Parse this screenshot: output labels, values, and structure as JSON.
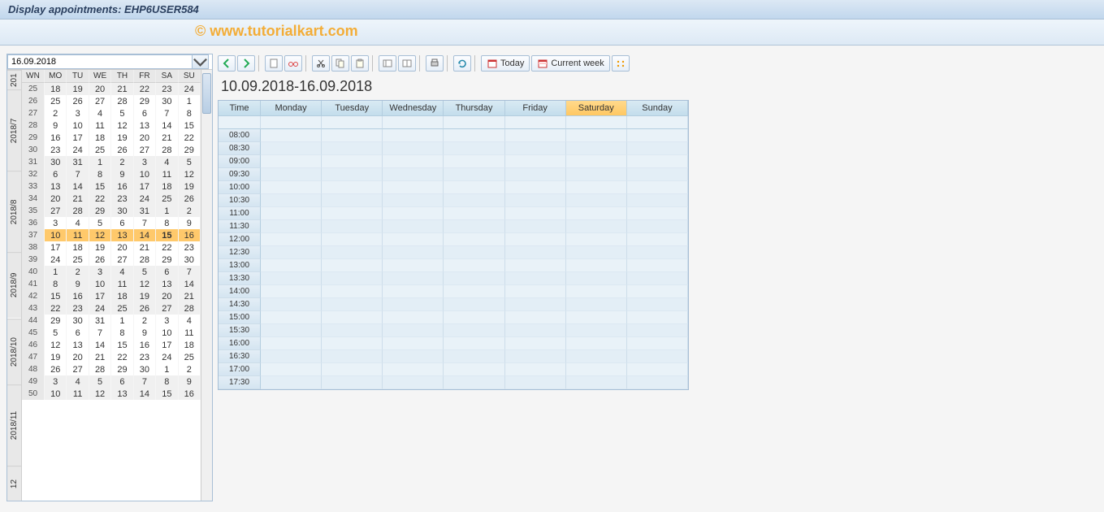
{
  "title": "Display appointments: EHP6USER584",
  "watermark": "© www.tutorialkart.com",
  "date_input": {
    "value": "16.09.2018"
  },
  "mini_cal": {
    "headers": [
      "WN",
      "MO",
      "TU",
      "WE",
      "TH",
      "FR",
      "SA",
      "SU"
    ],
    "months": [
      {
        "label": "201",
        "rows": [
          [
            25,
            18,
            19,
            20,
            21,
            22,
            23,
            24
          ]
        ],
        "class": "alt-month"
      },
      {
        "label": "2018/7",
        "rows": [
          [
            26,
            25,
            26,
            27,
            28,
            29,
            30,
            1
          ],
          [
            27,
            2,
            3,
            4,
            5,
            6,
            7,
            8
          ],
          [
            28,
            9,
            10,
            11,
            12,
            13,
            14,
            15
          ],
          [
            29,
            16,
            17,
            18,
            19,
            20,
            21,
            22
          ],
          [
            30,
            23,
            24,
            25,
            26,
            27,
            28,
            29
          ]
        ],
        "class": "cur-month"
      },
      {
        "label": "2018/8",
        "rows": [
          [
            31,
            30,
            31,
            1,
            2,
            3,
            4,
            5
          ],
          [
            32,
            6,
            7,
            8,
            9,
            10,
            11,
            12
          ],
          [
            33,
            13,
            14,
            15,
            16,
            17,
            18,
            19
          ],
          [
            34,
            20,
            21,
            22,
            23,
            24,
            25,
            26
          ],
          [
            35,
            27,
            28,
            29,
            30,
            31,
            1,
            2
          ]
        ],
        "class": "alt-month"
      },
      {
        "label": "2018/9",
        "rows": [
          [
            36,
            3,
            4,
            5,
            6,
            7,
            8,
            9
          ],
          [
            37,
            10,
            11,
            12,
            13,
            14,
            15,
            16
          ],
          [
            38,
            17,
            18,
            19,
            20,
            21,
            22,
            23
          ],
          [
            39,
            24,
            25,
            26,
            27,
            28,
            29,
            30
          ]
        ],
        "class": "cur-month",
        "highlight_wn": 37,
        "today": 15
      },
      {
        "label": "2018/10",
        "rows": [
          [
            40,
            1,
            2,
            3,
            4,
            5,
            6,
            7
          ],
          [
            41,
            8,
            9,
            10,
            11,
            12,
            13,
            14
          ],
          [
            42,
            15,
            16,
            17,
            18,
            19,
            20,
            21
          ],
          [
            43,
            22,
            23,
            24,
            25,
            26,
            27,
            28
          ]
        ],
        "class": "alt-month"
      },
      {
        "label": "2018/11",
        "rows": [
          [
            44,
            29,
            30,
            31,
            1,
            2,
            3,
            4
          ],
          [
            45,
            5,
            6,
            7,
            8,
            9,
            10,
            11
          ],
          [
            46,
            12,
            13,
            14,
            15,
            16,
            17,
            18
          ],
          [
            47,
            19,
            20,
            21,
            22,
            23,
            24,
            25
          ],
          [
            48,
            26,
            27,
            28,
            29,
            30,
            1,
            2
          ]
        ],
        "class": "cur-month"
      },
      {
        "label": "12",
        "rows": [
          [
            49,
            3,
            4,
            5,
            6,
            7,
            8,
            9
          ],
          [
            50,
            10,
            11,
            12,
            13,
            14,
            15,
            16
          ]
        ],
        "class": "alt-month"
      }
    ]
  },
  "toolbar": {
    "back": "back-icon",
    "forward": "forward-icon",
    "new": "new-icon",
    "display": "display-icon",
    "cut": "cut-icon",
    "copy": "copy-icon",
    "paste": "paste-icon",
    "layout1": "layout-icon",
    "layout2": "layout-split-icon",
    "print": "print-icon",
    "refresh": "refresh-icon",
    "today_label": "Today",
    "week_label": "Current week",
    "more": "more-icon"
  },
  "schedule": {
    "range": "10.09.2018-16.09.2018",
    "time_label": "Time",
    "days": [
      "Monday",
      "Tuesday",
      "Wednesday",
      "Thursday",
      "Friday",
      "Saturday",
      "Sunday"
    ],
    "times": [
      "08:00",
      "08:30",
      "09:00",
      "09:30",
      "10:00",
      "10:30",
      "11:00",
      "11:30",
      "12:00",
      "12:30",
      "13:00",
      "13:30",
      "14:00",
      "14:30",
      "15:00",
      "15:30",
      "16:00",
      "16:30",
      "17:00",
      "17:30"
    ]
  }
}
